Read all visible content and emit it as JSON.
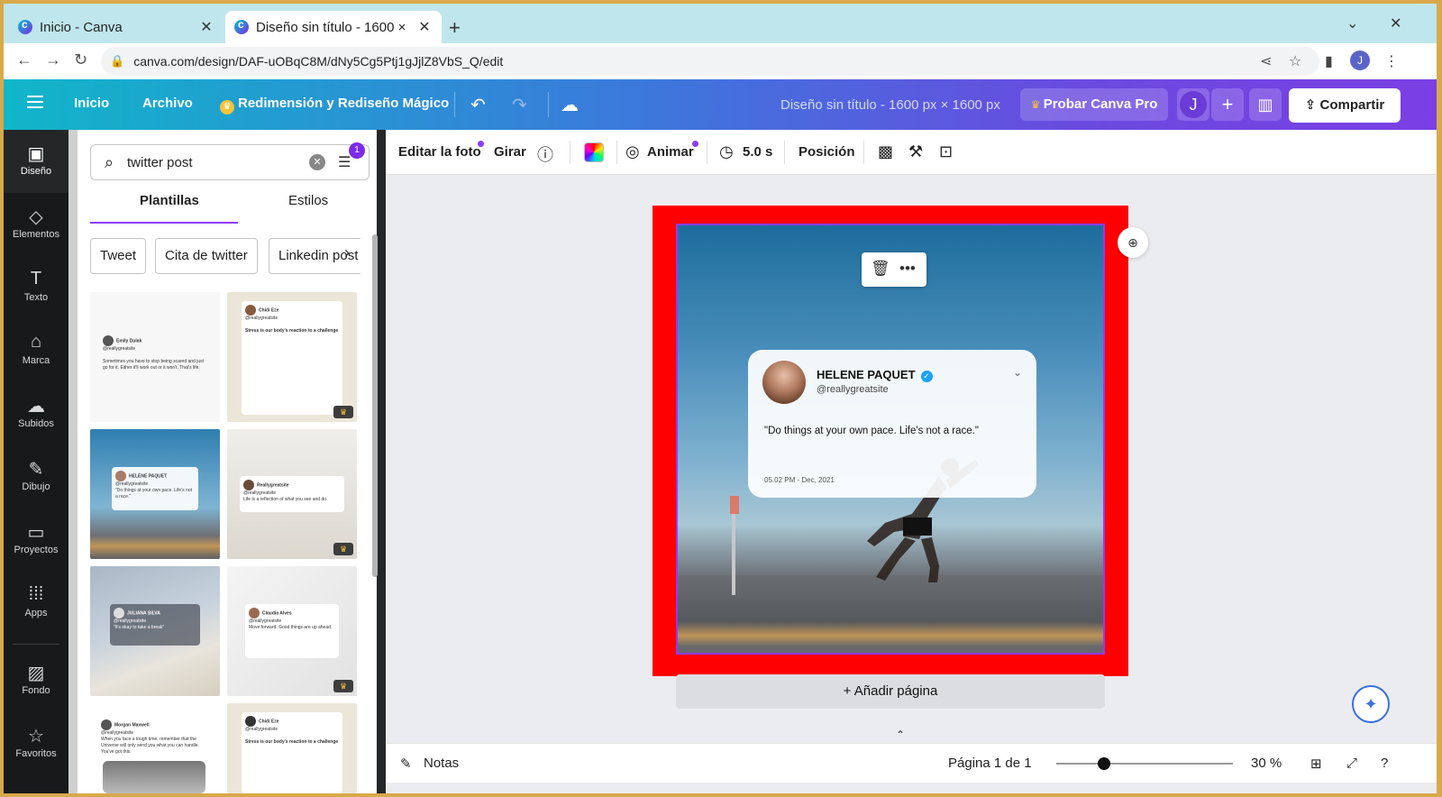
{
  "browser": {
    "tabs": [
      {
        "title": "Inicio - Canva",
        "active": false
      },
      {
        "title": "Diseño sin título - 1600 ×",
        "active": true
      }
    ],
    "url": "canva.com/design/DAF-uOBqC8M/dNy5Cg5Ptj1gJjlZ8VbS_Q/edit",
    "profile_initial": "J"
  },
  "header": {
    "menu": [
      "Inicio",
      "Archivo"
    ],
    "magic_resize": "Redimensión y Rediseño Mágico",
    "design_title": "Diseño sin título - 1600 px × 1600 px",
    "pro_button": "Probar Canva Pro",
    "avatar": "J",
    "share": "Compartir"
  },
  "rail": [
    {
      "label": "Diseño",
      "icon": "layout-icon"
    },
    {
      "label": "Elementos",
      "icon": "shapes-icon"
    },
    {
      "label": "Texto",
      "icon": "text-icon"
    },
    {
      "label": "Marca",
      "icon": "brand-icon"
    },
    {
      "label": "Subidos",
      "icon": "upload-cloud-icon"
    },
    {
      "label": "Dibujo",
      "icon": "pen-icon"
    },
    {
      "label": "Proyectos",
      "icon": "folder-icon"
    },
    {
      "label": "Apps",
      "icon": "apps-grid-icon"
    },
    {
      "label": "Fondo",
      "icon": "background-icon"
    },
    {
      "label": "Favoritos",
      "icon": "star-icon"
    }
  ],
  "panel": {
    "search_value": "twitter post",
    "filter_badge": "1",
    "tabs": [
      "Plantillas",
      "Estilos"
    ],
    "chips": [
      "Tweet",
      "Cita de twitter",
      "Linkedin post"
    ],
    "templates": [
      {
        "name": "Emily Dulak",
        "handle": "@reallygreatsite",
        "text": "Sometimes you have to stop being scared and just go for it. Either it'll work out or it won't. That's life.",
        "pro": false
      },
      {
        "name": "Chidi Eze",
        "handle": "@reallygreatsite",
        "text": "Stress is our body's reaction to a challenge",
        "pro": true
      },
      {
        "name": "HELENE PAQUET",
        "handle": "@reallygreatsite",
        "text": "\"Do things at your own pace. Life's not a race.\"",
        "pro": false
      },
      {
        "name": "Reallygreatsite",
        "handle": "@reallygreatsite",
        "text": "Life is a reflection of what you see and do.",
        "pro": true
      },
      {
        "name": "JULIANA SILVA",
        "handle": "@reallygreatsite",
        "text": "\"It's okay to take a break\"",
        "pro": false
      },
      {
        "name": "Claudia Alves",
        "handle": "@reallygreatsite",
        "text": "Move forward. Good things are up ahead.",
        "pro": true
      },
      {
        "name": "Morgan Maxwell",
        "handle": "@reallygreatsite",
        "text": "When you face a tough time, remember that the Universe will only send you what you can handle. You've got this.",
        "pro": false
      },
      {
        "name": "Chidi Eze",
        "handle": "@reallygreatsite",
        "text": "Stress is our body's reaction to a challenge",
        "pro": false
      }
    ]
  },
  "toolbar": {
    "edit_photo": "Editar la foto",
    "rotate": "Girar",
    "animate": "Animar",
    "duration": "5.0 s",
    "position": "Posición"
  },
  "canvas": {
    "tweet": {
      "name": "HELENE PAQUET",
      "handle": "@reallygreatsite",
      "text": "\"Do things at your own pace. Life's not a race.\"",
      "date": "05.02 PM - Dec, 2021"
    },
    "add_page": "+ Añadir página"
  },
  "footer": {
    "notes": "Notas",
    "page": "Página 1 de 1",
    "zoom": "30 %",
    "zoom_fraction": 0.3
  },
  "colors": {
    "accent": "#8b3dff",
    "selection_frame": "#ff0000"
  }
}
